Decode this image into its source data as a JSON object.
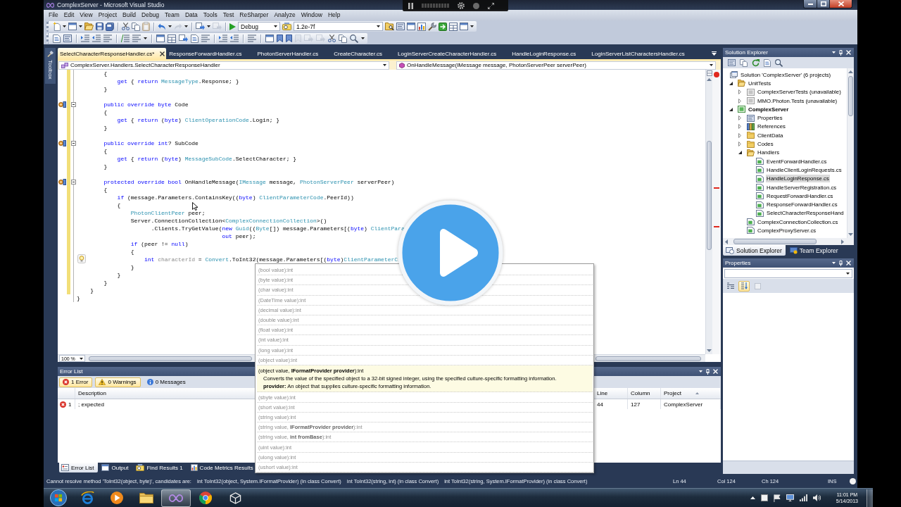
{
  "window": {
    "title": "ComplexServer - Microsoft Visual Studio"
  },
  "menu": [
    "File",
    "Edit",
    "View",
    "Project",
    "Build",
    "Debug",
    "Team",
    "Data",
    "Tools",
    "Test",
    "ReSharper",
    "Analyze",
    "Window",
    "Help"
  ],
  "toolbar": {
    "configuration": "Debug",
    "find_text": "1.2e-7f"
  },
  "document_tabs": [
    {
      "label": "SelectCharacterResponseHandler.cs*",
      "selected": true
    },
    {
      "label": "ResponseForwardHandler.cs",
      "selected": false
    },
    {
      "label": "PhotonServerHandler.cs",
      "selected": false
    },
    {
      "label": "CreateCharacter.cs",
      "selected": false
    },
    {
      "label": "LoginServerCreateCharacterHandler.cs",
      "selected": false
    },
    {
      "label": "HandleLoginResponse.cs",
      "selected": false
    },
    {
      "label": "LoginServerListCharactersHandler.cs",
      "selected": false
    }
  ],
  "toolbox": {
    "label": "Toolbox"
  },
  "navigation_bar": {
    "type": "ComplexServer.Handlers.SelectCharacterResponseHandler",
    "member": "OnHandleMessage(IMessage message, PhotonServerPeer serverPeer)"
  },
  "editor": {
    "lines": [
      {
        "modified": true,
        "tokens": [
          {
            "text": "        {"
          }
        ]
      },
      {
        "modified": true,
        "tokens": [
          {
            "kind": "keyword",
            "text": "            get"
          },
          {
            "text": " { "
          },
          {
            "kind": "keyword",
            "text": "return "
          },
          {
            "kind": "type",
            "text": "MessageType"
          },
          {
            "text": ".Response; }"
          }
        ]
      },
      {
        "modified": true,
        "tokens": [
          {
            "text": "        }"
          }
        ]
      },
      {
        "modified": true
      },
      {
        "modified": true,
        "overrides": true,
        "expanded": true,
        "tokens": [
          {
            "kind": "keyword",
            "text": "        public override byte"
          },
          {
            "text": " Code"
          }
        ]
      },
      {
        "modified": true,
        "tokens": [
          {
            "text": "        {"
          }
        ]
      },
      {
        "modified": true,
        "tokens": [
          {
            "kind": "keyword",
            "text": "            get"
          },
          {
            "text": " { "
          },
          {
            "kind": "keyword",
            "text": "return"
          },
          {
            "text": " ("
          },
          {
            "kind": "keyword",
            "text": "byte"
          },
          {
            "text": ") "
          },
          {
            "kind": "type",
            "text": "ClientOperationCode"
          },
          {
            "text": ".Login; }"
          }
        ]
      },
      {
        "modified": true,
        "tokens": [
          {
            "text": "        }"
          }
        ]
      },
      {
        "modified": true
      },
      {
        "modified": true,
        "overrides": true,
        "expanded": true,
        "tokens": [
          {
            "kind": "keyword",
            "text": "        public override int"
          },
          {
            "text": "? SubCode"
          }
        ]
      },
      {
        "modified": true,
        "tokens": [
          {
            "text": "        {"
          }
        ]
      },
      {
        "modified": true,
        "tokens": [
          {
            "kind": "keyword",
            "text": "            get"
          },
          {
            "text": " { "
          },
          {
            "kind": "keyword",
            "text": "return"
          },
          {
            "text": " ("
          },
          {
            "kind": "keyword",
            "text": "byte"
          },
          {
            "text": ") "
          },
          {
            "kind": "type",
            "text": "MessageSubCode"
          },
          {
            "text": ".SelectCharacter; }"
          }
        ]
      },
      {
        "modified": true,
        "tokens": [
          {
            "text": "        }"
          }
        ]
      },
      {
        "modified": true
      },
      {
        "modified": true,
        "overrides": true,
        "expanded": true,
        "tokens": [
          {
            "kind": "keyword",
            "text": "        protected override bool"
          },
          {
            "text": " OnHandleMessage("
          },
          {
            "kind": "type",
            "text": "IMessage"
          },
          {
            "text": " message, "
          },
          {
            "kind": "type",
            "text": "PhotonServerPeer"
          },
          {
            "text": " serverPeer)"
          }
        ]
      },
      {
        "modified": true,
        "tokens": [
          {
            "text": "        {"
          }
        ]
      },
      {
        "modified": true,
        "tokens": [
          {
            "kind": "keyword",
            "text": "            if"
          },
          {
            "text": " (message.Parameters.ContainsKey(("
          },
          {
            "kind": "keyword",
            "text": "byte"
          },
          {
            "text": ") "
          },
          {
            "kind": "type",
            "text": "ClientParameterCode"
          },
          {
            "text": ".PeerId))"
          }
        ]
      },
      {
        "modified": true,
        "tokens": [
          {
            "text": "            {"
          }
        ]
      },
      {
        "modified": true,
        "tokens": [
          {
            "kind": "type",
            "text": "                PhotonClientPeer"
          },
          {
            "text": " peer;"
          }
        ]
      },
      {
        "modified": true,
        "tokens": [
          {
            "text": "                Server.ConnectionCollection<"
          },
          {
            "kind": "type",
            "text": "ComplexConnectionCollection"
          },
          {
            "text": ">()"
          }
        ]
      },
      {
        "modified": true,
        "tokens": [
          {
            "text": "                      .Clients.TryGetValue("
          },
          {
            "kind": "keyword",
            "text": "new "
          },
          {
            "kind": "type",
            "text": "Guid"
          },
          {
            "text": "(("
          },
          {
            "kind": "type",
            "text": "Byte"
          },
          {
            "text": "[]) message.Parameters[("
          },
          {
            "kind": "keyword",
            "text": "byte"
          },
          {
            "text": ") "
          },
          {
            "kind": "type",
            "text": "ClientPara"
          }
        ]
      },
      {
        "modified": true,
        "tokens": [
          {
            "kind": "keyword",
            "text": "                                           out"
          },
          {
            "text": " peer);"
          }
        ]
      },
      {
        "modified": true,
        "tokens": [
          {
            "kind": "keyword",
            "text": "                if"
          },
          {
            "text": " (peer != "
          },
          {
            "kind": "keyword",
            "text": "null"
          },
          {
            "text": ")"
          }
        ]
      },
      {
        "modified": true,
        "tokens": [
          {
            "text": "                {"
          }
        ]
      },
      {
        "modified": true,
        "lightbulb": true,
        "tokens": [
          {
            "kind": "keyword",
            "text": "                    int "
          },
          {
            "kind": "unused",
            "text": "characterId"
          },
          {
            "text": " = "
          },
          {
            "kind": "type",
            "text": "Convert"
          },
          {
            "text": ".ToInt32(message.Parameters[("
          },
          {
            "kind": "keyword",
            "text": "byte"
          },
          {
            "text": ")"
          },
          {
            "kind": "type",
            "text": "ClientParameterC"
          }
        ]
      },
      {
        "modified": true,
        "tokens": [
          {
            "text": "                }"
          }
        ]
      },
      {
        "modified": true,
        "tokens": [
          {
            "text": "            }"
          }
        ]
      },
      {
        "modified": true,
        "tokens": [
          {
            "text": "        }"
          }
        ]
      },
      {
        "modified": true,
        "tokens": [
          {
            "text": "    }"
          }
        ]
      },
      {
        "modified": false,
        "tokens": [
          {
            "text": "}"
          }
        ]
      }
    ],
    "zoom": "100 %"
  },
  "intellisense": {
    "overloads": [
      {
        "signature": "(bool value):int",
        "selected": false
      },
      {
        "signature": "(byte value):int",
        "selected": false
      },
      {
        "signature": "(char value):int",
        "selected": false
      },
      {
        "signature": "(DateTime value):int",
        "selected": false
      },
      {
        "signature": "(decimal value):int",
        "selected": false
      },
      {
        "signature": "(double value):int",
        "selected": false
      },
      {
        "signature": "(float value):int",
        "selected": false
      },
      {
        "signature": "(int value):int",
        "selected": false
      },
      {
        "signature": "(long value):int",
        "selected": false
      },
      {
        "signature": "(object value):int",
        "selected": false
      },
      {
        "signature": "(object value, **IFormatProvider provider**):int",
        "selected": true,
        "description": "Converts the value of the specified object to a 32-bit signed integer, using the specified culture-specific formatting information.",
        "parameter": "**provider:** An object that supplies culture-specific formatting information."
      },
      {
        "signature": "(sbyte value):int",
        "selected": false
      },
      {
        "signature": "(short value):int",
        "selected": false
      },
      {
        "signature": "(string value):int",
        "selected": false
      },
      {
        "signature": "(string value, **IFormatProvider provider**):int",
        "selected": false
      },
      {
        "signature": "(string value, **int fromBase**):int",
        "selected": false
      },
      {
        "signature": "(uint value):int",
        "selected": false
      },
      {
        "signature": "(ulong value):int",
        "selected": false
      },
      {
        "signature": "(ushort value):int",
        "selected": false
      }
    ]
  },
  "error_list": {
    "title": "Error List",
    "filters": [
      {
        "kind": "error",
        "label": "1 Error",
        "on": true
      },
      {
        "kind": "warning",
        "label": "0 Warnings",
        "on": true
      },
      {
        "kind": "message",
        "label": "0 Messages",
        "on": false
      }
    ],
    "columns": [
      "Description",
      "Line",
      "Column",
      "Project"
    ],
    "rows": [
      {
        "kind": "error",
        "number": "1",
        "description": "; expected",
        "line": "44",
        "column": "127",
        "project": "ComplexServer"
      }
    ]
  },
  "output_tabs": [
    {
      "label": "Error List",
      "selected": true
    },
    {
      "label": "Output",
      "selected": false
    },
    {
      "label": "Find Results 1",
      "selected": false
    },
    {
      "label": "Code Metrics Results",
      "selected": false
    }
  ],
  "solution_explorer": {
    "title": "Solution Explorer",
    "tree": [
      {
        "label": "Solution 'ComplexServer' (6 projects)",
        "kind": "solution",
        "selected": false,
        "children": [
          {
            "label": "UnitTests",
            "kind": "solution-folder",
            "selected": false,
            "expanded": true,
            "children": [
              {
                "label": "ComplexServerTests (unavailable)",
                "kind": "unavailable-project",
                "selected": false,
                "expanded": false
              },
              {
                "label": "MMO.Photon.Tests (unavailable)",
                "kind": "unavailable-project",
                "selected": false,
                "expanded": false
              }
            ]
          },
          {
            "label": "ComplexServer",
            "kind": "startup-project",
            "selected": false,
            "expanded": true,
            "children": [
              {
                "label": "Properties",
                "kind": "properties",
                "selected": false,
                "expanded": false
              },
              {
                "label": "References",
                "kind": "references",
                "selected": false,
                "expanded": false
              },
              {
                "label": "ClientData",
                "kind": "folder",
                "selected": false,
                "expanded": false
              },
              {
                "label": "Codes",
                "kind": "folder",
                "selected": false,
                "expanded": false
              },
              {
                "label": "Handlers",
                "kind": "folder",
                "selected": false,
                "expanded": true,
                "children": [
                  {
                    "label": "EventForwardHandler.cs",
                    "kind": "cs-file",
                    "selected": false
                  },
                  {
                    "label": "HandleClientLoginRequests.cs",
                    "kind": "cs-file",
                    "selected": false
                  },
                  {
                    "label": "HandleLoginResponse.cs",
                    "kind": "cs-file",
                    "selected": true
                  },
                  {
                    "label": "HandleServerRegistration.cs",
                    "kind": "cs-file",
                    "selected": false
                  },
                  {
                    "label": "RequestForwardHandler.cs",
                    "kind": "cs-file",
                    "selected": false
                  },
                  {
                    "label": "ResponseForwardHandler.cs",
                    "kind": "cs-file",
                    "selected": false
                  },
                  {
                    "label": "SelectCharacterResponseHand",
                    "kind": "cs-file",
                    "selected": false
                  }
                ]
              },
              {
                "label": "ComplexConnectionCollection.cs",
                "kind": "cs-file",
                "selected": false
              },
              {
                "label": "ComplexProxyServer.cs",
                "kind": "cs-file",
                "selected": false
              }
            ]
          }
        ]
      }
    ],
    "tabs": [
      {
        "label": "Solution Explorer",
        "selected": true
      },
      {
        "label": "Team Explorer",
        "selected": false
      }
    ]
  },
  "properties": {
    "title": "Properties",
    "sort_buttons": [
      {
        "kind": "categorized",
        "selected": false
      },
      {
        "kind": "alphabetical",
        "selected": true
      }
    ]
  },
  "status_bar": {
    "messages": [
      "Cannot resolve method 'ToInt32(object, byte)', candidates are:",
      "int ToInt32(object, System.IFormatProvider) (in class Convert)",
      "int ToInt32(string, int) (in class Convert)",
      "int ToInt32(string, System.IFormatProvider) (in class Convert)"
    ],
    "line": "Ln 44",
    "column": "Col 124",
    "char": "Ch 124",
    "mode": "INS"
  },
  "taskbar": {
    "apps": [
      {
        "selected": false
      },
      {
        "selected": false
      },
      {
        "selected": false
      },
      {
        "selected": true
      },
      {
        "selected": false
      },
      {
        "selected": false
      }
    ],
    "time": "11:01 PM",
    "date": "5/14/2013"
  }
}
